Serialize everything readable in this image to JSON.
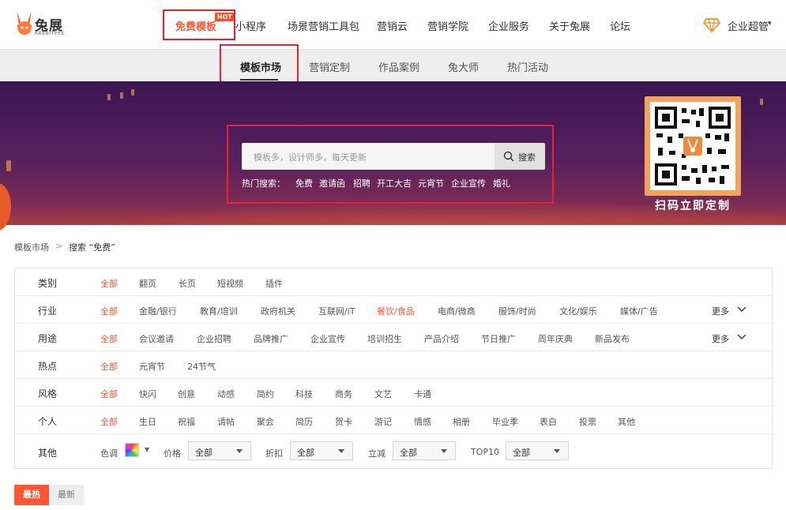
{
  "brand": {
    "name": "兔展",
    "sub": "RABBITPRE",
    "accent": "#ff5b33"
  },
  "nav": {
    "items": [
      "免费模板",
      "小程序",
      "场景营销工具包",
      "营销云",
      "营销学院",
      "企业服务",
      "关于兔展",
      "论坛"
    ],
    "hot_badge": "HOT",
    "user": "企业超管",
    "user_caret": "▾"
  },
  "subnav": {
    "items": [
      "模板市场",
      "营销定制",
      "作品案例",
      "兔大师",
      "热门活动"
    ]
  },
  "search": {
    "placeholder": "模板多，设计师多，每天更新",
    "button": "搜索",
    "hot_label": "热门搜索：",
    "hot_words": [
      "免费",
      "邀请函",
      "招聘",
      "开工大吉",
      "元宵节",
      "企业宣传",
      "婚礼"
    ]
  },
  "qr": {
    "caption": "扫码立即定制"
  },
  "breadcrumb": {
    "root": "模板市场",
    "sep": ">",
    "current": "搜索 “免费”"
  },
  "filters": {
    "rows": [
      {
        "title": "类别",
        "options": [
          "全部",
          "翻页",
          "长页",
          "短视频",
          "插件"
        ],
        "more": ""
      },
      {
        "title": "行业",
        "options": [
          "全部",
          "金融/银行",
          "教育/培训",
          "政府机关",
          "互联网/iT",
          "餐饮/食品",
          "电商/微商",
          "服饰/时尚",
          "文化/娱乐",
          "媒体/广告"
        ],
        "more": "更多"
      },
      {
        "title": "用途",
        "options": [
          "全部",
          "会议邀请",
          "企业招聘",
          "品牌推广",
          "企业宣传",
          "培训招生",
          "产品介绍",
          "节日推广",
          "周年庆典",
          "新品发布"
        ],
        "more": "更多"
      },
      {
        "title": "热点",
        "options": [
          "全部",
          "元宵节",
          "24节气"
        ],
        "more": ""
      },
      {
        "title": "风格",
        "options": [
          "全部",
          "快闪",
          "创意",
          "动感",
          "简约",
          "科技",
          "商务",
          "文艺",
          "卡通"
        ],
        "more": ""
      },
      {
        "title": "个人",
        "options": [
          "全部",
          "生日",
          "祝福",
          "请帖",
          "聚会",
          "简历",
          "贺卡",
          "游记",
          "情感",
          "相册",
          "毕业季",
          "表白",
          "投票",
          "其他"
        ],
        "more": ""
      }
    ],
    "other": {
      "title": "其他",
      "color_label": "色调",
      "price_label": "价格",
      "price_value": "全部",
      "discount_label": "折扣",
      "discount_value": "全部",
      "instant_label": "立减",
      "instant_value": "全部",
      "top10_label": "TOP10",
      "top10_value": "全部"
    }
  },
  "sort": {
    "hot": "最热",
    "new": "最新"
  }
}
